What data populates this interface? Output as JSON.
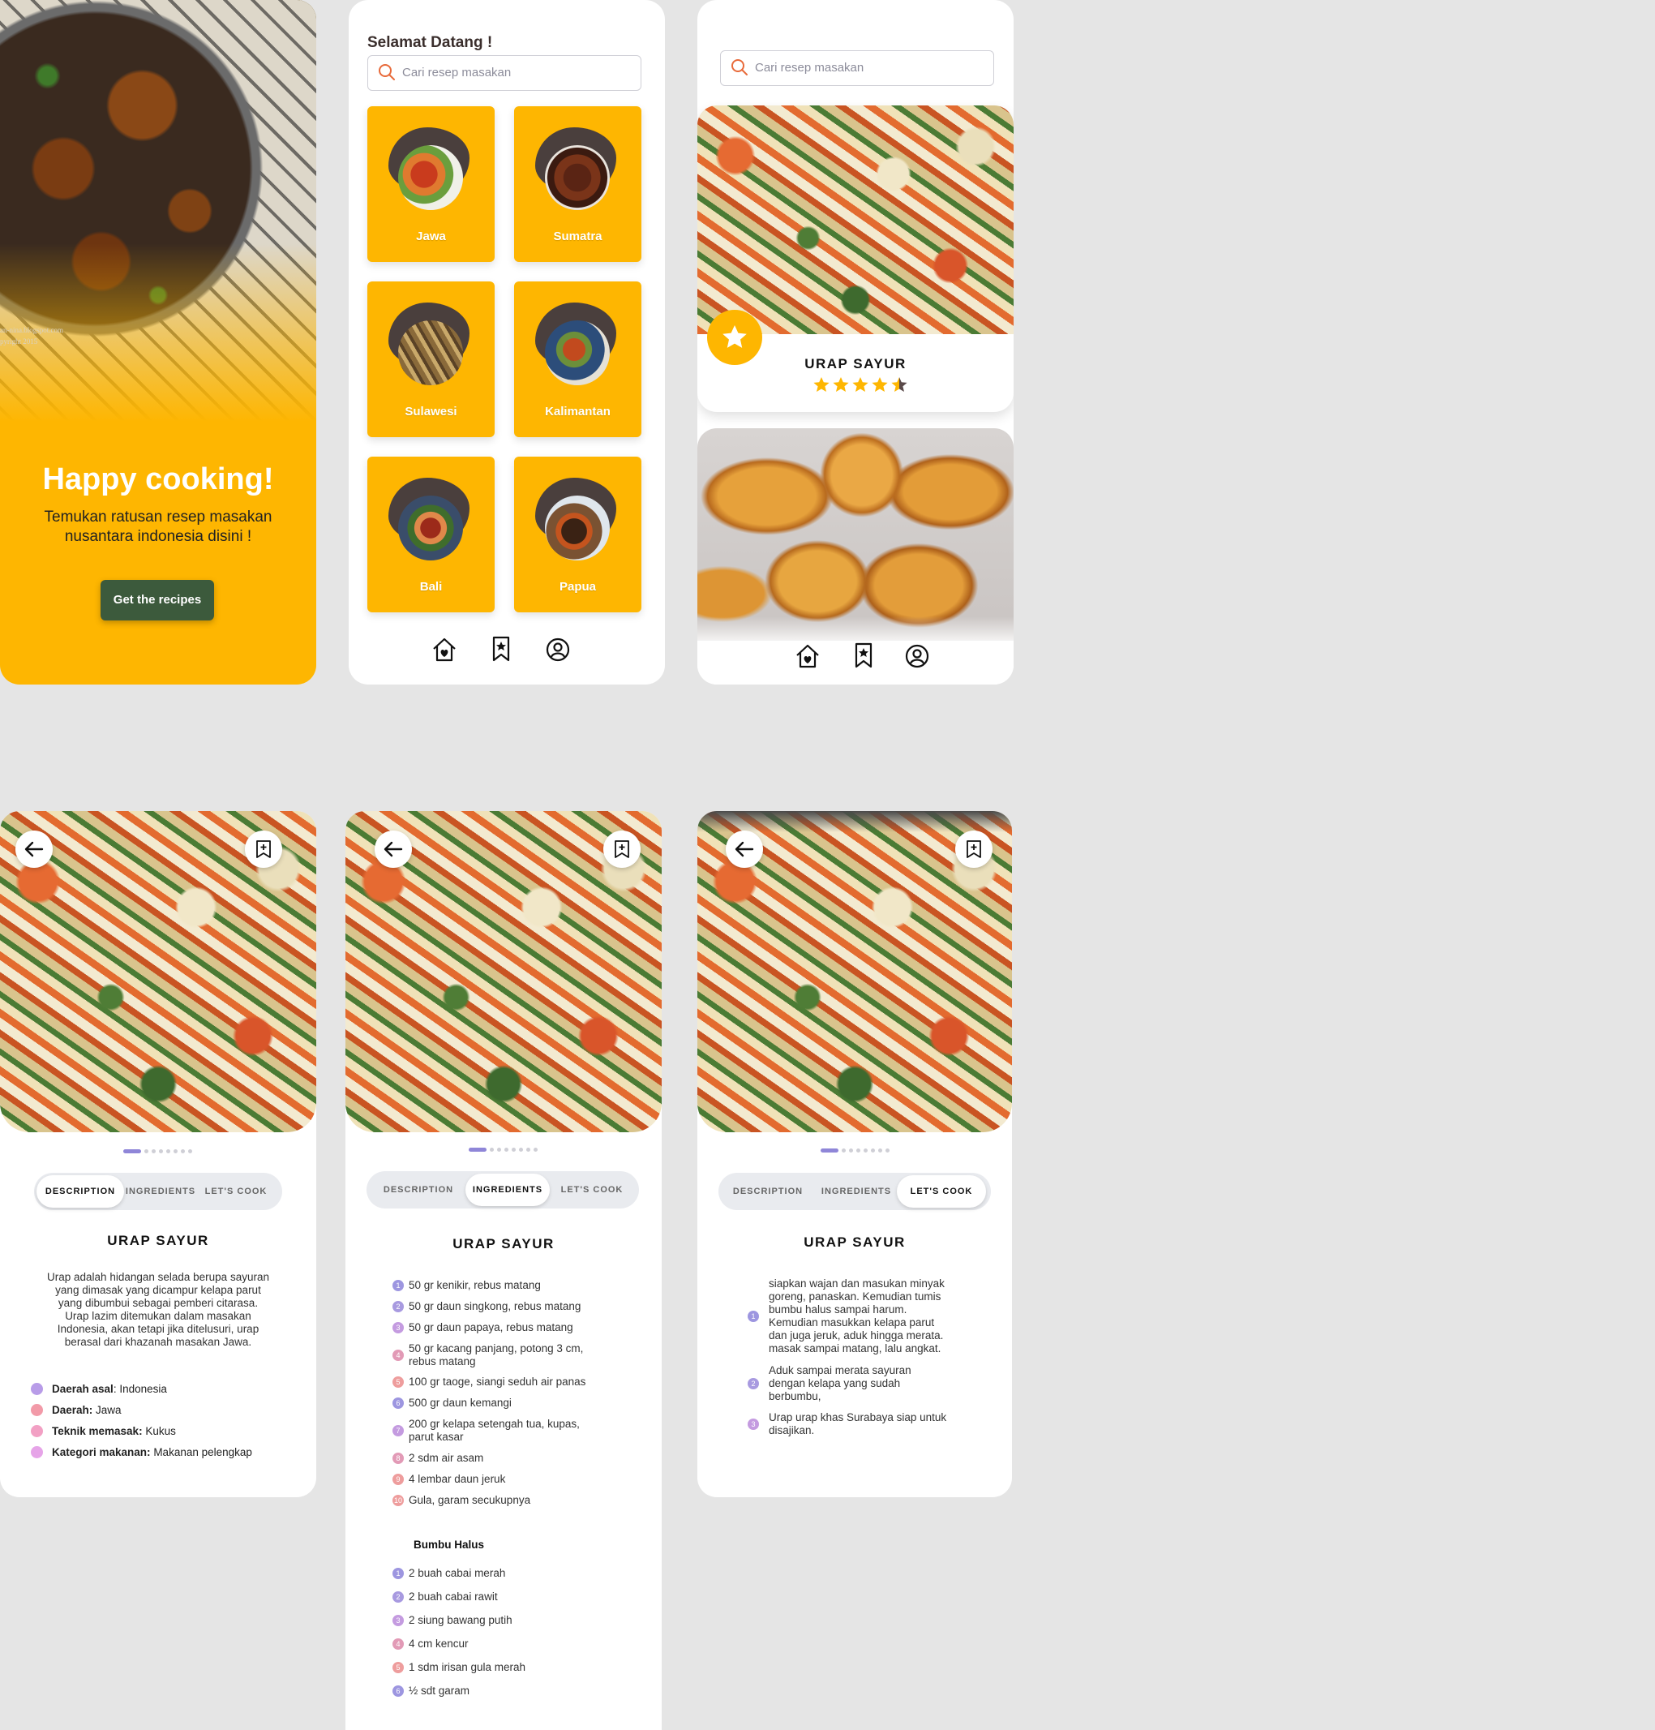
{
  "colors": {
    "accent": "#feb601",
    "dark_button": "#3c5a3c",
    "tab_active_indicator": "#8f86d8"
  },
  "onboarding": {
    "headline": "Happy cooking!",
    "subtitle_line1": "Temukan ratusan resep masakan",
    "subtitle_line2": "nusantara indonesia disini !",
    "cta": "Get the recipes",
    "photo_watermark_1": "an-nina.blogspot.com",
    "photo_watermark_2": "pyright 2015"
  },
  "home": {
    "greeting": "Selamat Datang !",
    "search_placeholder": "Cari resep masakan",
    "regions": [
      "Jawa",
      "Sumatra",
      "Sulawesi",
      "Kalimantan",
      "Bali",
      "Papua"
    ],
    "nav_icons": [
      "home-heart-icon",
      "bookmark-star-icon",
      "profile-icon"
    ]
  },
  "list": {
    "search_placeholder": "Cari resep masakan",
    "featured_title": "URAP SAYUR",
    "featured_rating": 4.5
  },
  "tabs": [
    "DESCRIPTION",
    "INGREDIENTS",
    "LET'S COOK"
  ],
  "detail_description": {
    "title": "URAP SAYUR",
    "paragraph": [
      "Urap adalah hidangan selada berupa sayuran",
      "yang dimasak yang dicampur kelapa parut",
      "yang dibumbui sebagai pemberi citarasa.",
      "Urap lazim ditemukan dalam masakan",
      "Indonesia, akan tetapi jika ditelusuri, urap",
      "berasal dari khazanah masakan Jawa."
    ],
    "facts": [
      {
        "label": "Daerah asal",
        "sep": ": ",
        "value": "Indonesia",
        "color": "#b89ce8"
      },
      {
        "label": "Daerah:",
        "sep": " ",
        "value": "Jawa",
        "color": "#f29aa8"
      },
      {
        "label": "Teknik memasak:",
        "sep": " ",
        "value": "Kukus",
        "color": "#f2a0c4"
      },
      {
        "label": "Kategori makanan:",
        "sep": " ",
        "value": "Makanan pelengkap",
        "color": "#e6a4e8"
      }
    ]
  },
  "detail_ingredients": {
    "title": "URAP SAYUR",
    "items": [
      "50 gr kenikir, rebus matang",
      "50 gr daun singkong, rebus matang",
      "50 gr daun papaya, rebus matang",
      "50 gr kacang panjang, potong 3 cm,|rebus matang",
      "100 gr taoge, siangi seduh air panas",
      "500 gr daun kemangi",
      "200 gr kelapa setengah tua, kupas,|parut kasar",
      "2 sdm air asam",
      "4 lembar daun jeruk",
      "Gula, garam secukupnya"
    ],
    "bumbu_title": "Bumbu Halus",
    "bumbu_items": [
      "2 buah cabai merah",
      "2 buah cabai rawit",
      "2 siung bawang putih",
      "4 cm kencur",
      "1 sdm irisan gula merah",
      "½ sdt garam"
    ],
    "number_colors": [
      "#9d96e0",
      "#a89ae0",
      "#c49be0",
      "#e29ab6",
      "#ee9d9d",
      "#9d96e0",
      "#c49be0",
      "#e29ab6",
      "#ee9d9d",
      "#ee9d9d"
    ]
  },
  "detail_cook": {
    "title": "URAP SAYUR",
    "steps": [
      [
        "siapkan wajan dan masukan minyak",
        "goreng, panaskan. Kemudian tumis",
        "bumbu halus sampai harum.",
        "Kemudian masukkan kelapa parut",
        "dan juga jeruk, aduk hingga merata.",
        "masak sampai matang, lalu angkat."
      ],
      [
        "Aduk sampai merata sayuran",
        "dengan kelapa yang sudah",
        "berbumbu,"
      ],
      [
        "Urap urap khas Surabaya siap untuk",
        "disajikan."
      ]
    ]
  }
}
